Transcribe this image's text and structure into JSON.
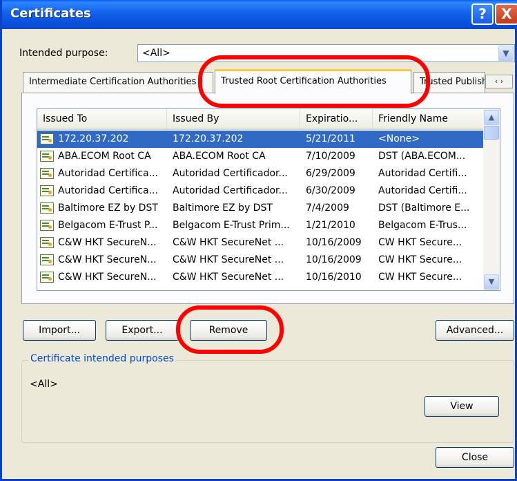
{
  "window": {
    "title": "Certificates",
    "help_glyph": "?",
    "close_glyph": "X"
  },
  "purpose": {
    "label": "Intended purpose:",
    "value": "<All>"
  },
  "tabs": [
    {
      "label": "Intermediate Certification Authorities",
      "active": false
    },
    {
      "label": "Trusted Root Certification Authorities",
      "active": true
    },
    {
      "label": "Trusted Publishers",
      "active": false
    }
  ],
  "tab_scroll": {
    "left": "‹",
    "right": "›"
  },
  "table": {
    "columns": [
      "Issued To",
      "Issued By",
      "Expiratio...",
      "Friendly Name"
    ],
    "rows": [
      {
        "issued_to": "172.20.37.202",
        "issued_by": "172.20.37.202",
        "expiration": "5/21/2011",
        "friendly_name": "<None>",
        "selected": true
      },
      {
        "issued_to": "ABA.ECOM Root CA",
        "issued_by": "ABA.ECOM Root CA",
        "expiration": "7/10/2009",
        "friendly_name": "DST (ABA.ECOM...",
        "selected": false
      },
      {
        "issued_to": "Autoridad Certifica...",
        "issued_by": "Autoridad Certificador...",
        "expiration": "6/29/2009",
        "friendly_name": "Autoridad Certifi...",
        "selected": false
      },
      {
        "issued_to": "Autoridad Certifica...",
        "issued_by": "Autoridad Certificador...",
        "expiration": "6/30/2009",
        "friendly_name": "Autoridad Certifi...",
        "selected": false
      },
      {
        "issued_to": "Baltimore EZ by DST",
        "issued_by": "Baltimore EZ by DST",
        "expiration": "7/4/2009",
        "friendly_name": "DST (Baltimore E...",
        "selected": false
      },
      {
        "issued_to": "Belgacom E-Trust P...",
        "issued_by": "Belgacom E-Trust Prim...",
        "expiration": "1/21/2010",
        "friendly_name": "Belgacom E-Trus...",
        "selected": false
      },
      {
        "issued_to": "C&W HKT SecureN...",
        "issued_by": "C&W HKT SecureNet ...",
        "expiration": "10/16/2009",
        "friendly_name": "CW HKT Secure...",
        "selected": false
      },
      {
        "issued_to": "C&W HKT SecureN...",
        "issued_by": "C&W HKT SecureNet ...",
        "expiration": "10/16/2009",
        "friendly_name": "CW HKT Secure...",
        "selected": false
      },
      {
        "issued_to": "C&W HKT SecureN...",
        "issued_by": "C&W HKT SecureNet ...",
        "expiration": "10/16/2010",
        "friendly_name": "CW HKT Secure...",
        "selected": false
      }
    ]
  },
  "buttons": {
    "import": "Import...",
    "export": "Export...",
    "remove": "Remove",
    "advanced": "Advanced...",
    "view": "View",
    "close": "Close"
  },
  "purposes_group": {
    "legend": "Certificate intended purposes",
    "value": "<All>"
  },
  "colors": {
    "annotation": "#ff0000",
    "selection": "#316ac5",
    "titlebar": "#0b52dc"
  }
}
